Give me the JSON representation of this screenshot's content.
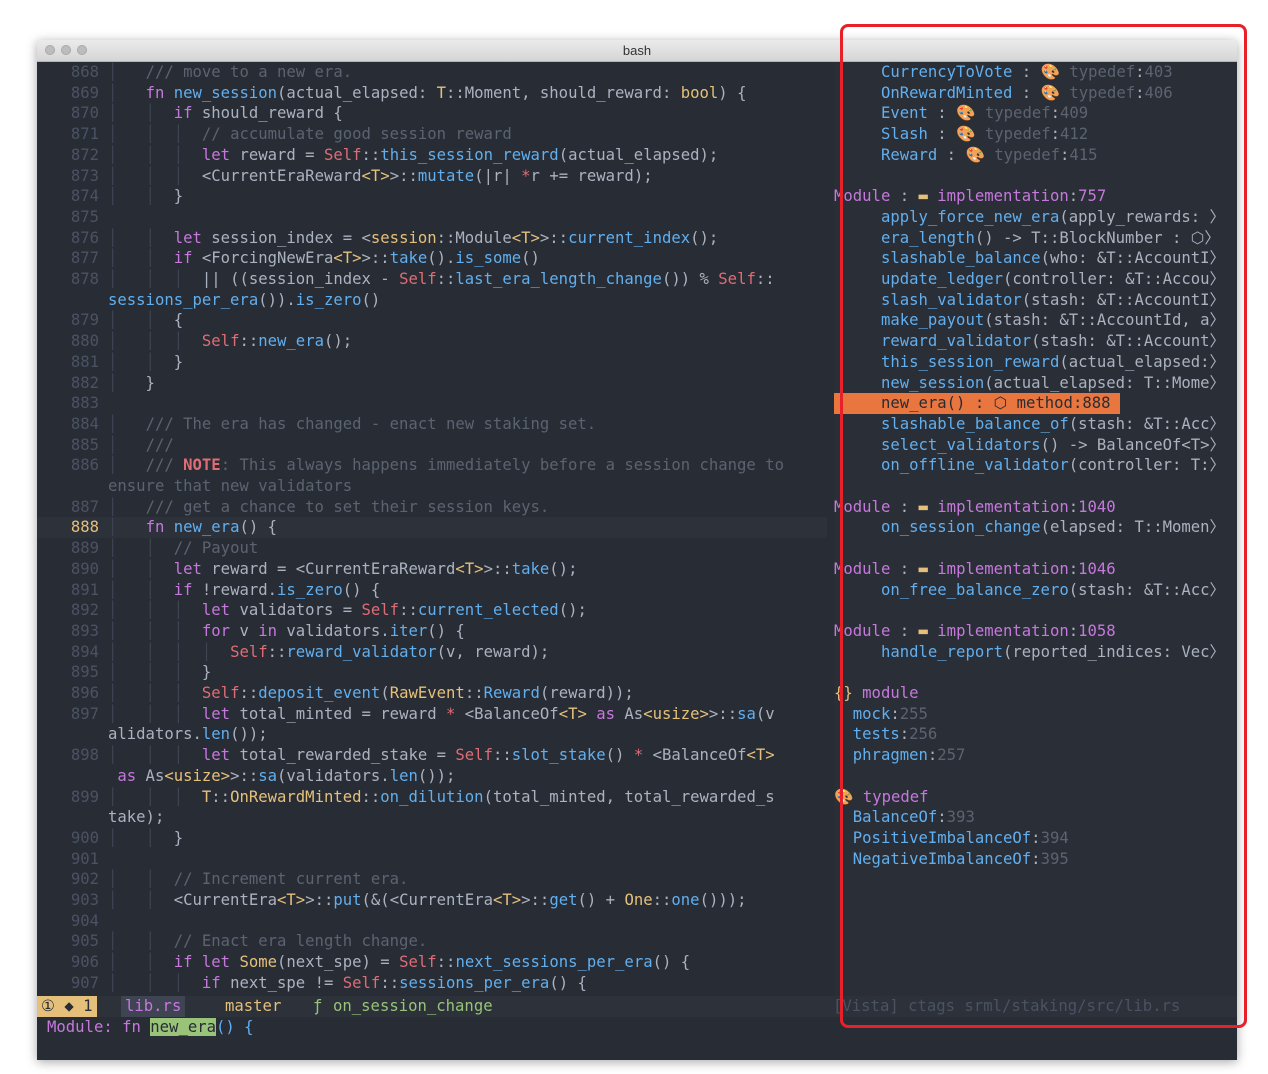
{
  "window": {
    "title": "bash"
  },
  "code": {
    "lines": [
      {
        "n": "868",
        "html": "<span class='guide'>│ </span>  <span class='cm'>/// move to a new era.</span>"
      },
      {
        "n": "869",
        "html": "<span class='guide'>│ </span>  <span class='kw'>fn</span> <span class='fn'>new_session</span>(actual_elapsed: <span class='ty'>T</span>::Moment, should_reward: <span class='ty'>bool</span>) {"
      },
      {
        "n": "870",
        "html": "<span class='guide'>│ </span>  <span class='guide'>│ </span> <span class='kw'>if</span> should_reward {"
      },
      {
        "n": "871",
        "html": "<span class='guide'>│ </span>  <span class='guide'>│ </span> <span class='guide'>│ </span> <span class='cm'>// accumulate good session reward</span>"
      },
      {
        "n": "872",
        "html": "<span class='guide'>│ </span>  <span class='guide'>│ </span> <span class='guide'>│ </span> <span class='kw'>let</span> reward = <span class='sf'>Self</span>::<span class='fn'>this_session_reward</span>(actual_elapsed);"
      },
      {
        "n": "873",
        "html": "<span class='guide'>│ </span>  <span class='guide'>│ </span> <span class='guide'>│ </span> &lt;CurrentEraReward<span class='ty'>&lt;T&gt;</span>&gt;::<span class='fn'>mutate</span>(|r| <span class='sf'>*</span>r += reward);"
      },
      {
        "n": "874",
        "html": "<span class='guide'>│ </span>  <span class='guide'>│ </span> }"
      },
      {
        "n": "875",
        "html": ""
      },
      {
        "n": "876",
        "html": "<span class='guide'>│ </span>  <span class='guide'>│ </span> <span class='kw'>let</span> session_index = &lt;<span class='ty'>session</span>::Module<span class='ty'>&lt;T&gt;</span>&gt;::<span class='fn'>current_index</span>();"
      },
      {
        "n": "877",
        "html": "<span class='guide'>│ </span>  <span class='guide'>│ </span> <span class='kw'>if</span> &lt;ForcingNewEra<span class='ty'>&lt;T&gt;</span>&gt;::<span class='fn'>take</span>().<span class='fn'>is_some</span>()"
      },
      {
        "n": "878",
        "html": "<span class='guide'>│ </span>  <span class='guide'>│ </span> <span class='guide'>│ </span> || ((session_index - <span class='sf'>Self</span>::<span class='fn'>last_era_length_change</span>()) % <span class='sf'>Self</span>::"
      },
      {
        "n": "",
        "wrap": true,
        "html": "<span class='fn'>sessions_per_era</span>()).<span class='fn'>is_zero</span>()"
      },
      {
        "n": "879",
        "html": "<span class='guide'>│ </span>  <span class='guide'>│ </span> {"
      },
      {
        "n": "880",
        "html": "<span class='guide'>│ </span>  <span class='guide'>│ </span> <span class='guide'>│ </span> <span class='sf'>Self</span>::<span class='fn'>new_era</span>();"
      },
      {
        "n": "881",
        "html": "<span class='guide'>│ </span>  <span class='guide'>│ </span> }"
      },
      {
        "n": "882",
        "html": "<span class='guide'>│ </span>  }"
      },
      {
        "n": "883",
        "html": ""
      },
      {
        "n": "884",
        "html": "<span class='guide'>│ </span>  <span class='cm'>/// The era has changed - enact new staking set.</span>"
      },
      {
        "n": "885",
        "html": "<span class='guide'>│ </span>  <span class='cm'>///</span>"
      },
      {
        "n": "886",
        "html": "<span class='guide'>│ </span>  <span class='cm'>/// </span><span class='note'>NOTE</span><span class='cm'>: This always happens immediately before a session change to</span>"
      },
      {
        "n": "",
        "wrap": true,
        "html": "<span class='cm'>ensure that new validators</span>"
      },
      {
        "n": "887",
        "html": "<span class='guide'>│ </span>  <span class='cm'>/// get a chance to set their session keys.</span>"
      },
      {
        "n": "888",
        "cur": true,
        "html": "<span class='guide'>│ </span>  <span class='kw'>fn</span> <span class='fn'>new_era</span>() {"
      },
      {
        "n": "889",
        "html": "<span class='guide'>│ </span>  <span class='guide'>│ </span> <span class='cm'>// Payout</span>"
      },
      {
        "n": "890",
        "html": "<span class='guide'>│ </span>  <span class='guide'>│ </span> <span class='kw'>let</span> reward = &lt;CurrentEraReward<span class='ty'>&lt;T&gt;</span>&gt;::<span class='fn'>take</span>();"
      },
      {
        "n": "891",
        "html": "<span class='guide'>│ </span>  <span class='guide'>│ </span> <span class='kw'>if</span> !reward.<span class='fn'>is_zero</span>() {"
      },
      {
        "n": "892",
        "html": "<span class='guide'>│ </span>  <span class='guide'>│ </span> <span class='guide'>│ </span> <span class='kw'>let</span> validators = <span class='sf'>Self</span>::<span class='fn'>current_elected</span>();"
      },
      {
        "n": "893",
        "html": "<span class='guide'>│ </span>  <span class='guide'>│ </span> <span class='guide'>│ </span> <span class='kw'>for</span> v <span class='kw'>in</span> validators.<span class='fn'>iter</span>() {"
      },
      {
        "n": "894",
        "html": "<span class='guide'>│ </span>  <span class='guide'>│ </span> <span class='guide'>│ </span> <span class='guide'>│ </span> <span class='sf'>Self</span>::<span class='fn'>reward_validator</span>(v, reward);"
      },
      {
        "n": "895",
        "html": "<span class='guide'>│ </span>  <span class='guide'>│ </span> <span class='guide'>│ </span> }"
      },
      {
        "n": "896",
        "html": "<span class='guide'>│ </span>  <span class='guide'>│ </span> <span class='guide'>│ </span> <span class='sf'>Self</span>::<span class='fn'>deposit_event</span>(<span class='ty'>RawEvent</span>::<span class='fn'>Reward</span>(reward));"
      },
      {
        "n": "897",
        "html": "<span class='guide'>│ </span>  <span class='guide'>│ </span> <span class='guide'>│ </span> <span class='kw'>let</span> total_minted = reward <span class='sf'>*</span> &lt;BalanceOf<span class='ty'>&lt;T&gt;</span> <span class='kw'>as</span> As<span class='ty'>&lt;usize&gt;</span>&gt;::<span class='fn'>sa</span>(v"
      },
      {
        "n": "",
        "wrap": true,
        "html": "alidators.<span class='fn'>len</span>());"
      },
      {
        "n": "898",
        "html": "<span class='guide'>│ </span>  <span class='guide'>│ </span> <span class='guide'>│ </span> <span class='kw'>let</span> total_rewarded_stake = <span class='sf'>Self</span>::<span class='fn'>slot_stake</span>() <span class='sf'>*</span> &lt;BalanceOf<span class='ty'>&lt;T&gt;</span>"
      },
      {
        "n": "",
        "wrap": true,
        "html": " <span class='kw'>as</span> As<span class='ty'>&lt;usize&gt;</span>&gt;::<span class='fn'>sa</span>(validators.<span class='fn'>len</span>());"
      },
      {
        "n": "899",
        "html": "<span class='guide'>│ </span>  <span class='guide'>│ </span> <span class='guide'>│ </span> <span class='ty'>T</span>::<span class='ty'>OnRewardMinted</span>::<span class='fn'>on_dilution</span>(total_minted, total_rewarded_s"
      },
      {
        "n": "",
        "wrap": true,
        "html": "take);"
      },
      {
        "n": "900",
        "html": "<span class='guide'>│ </span>  <span class='guide'>│ </span> }"
      },
      {
        "n": "901",
        "html": ""
      },
      {
        "n": "902",
        "html": "<span class='guide'>│ </span>  <span class='guide'>│ </span> <span class='cm'>// Increment current era.</span>"
      },
      {
        "n": "903",
        "html": "<span class='guide'>│ </span>  <span class='guide'>│ </span> &lt;CurrentEra<span class='ty'>&lt;T&gt;</span>&gt;::<span class='fn'>put</span>(&amp;(&lt;CurrentEra<span class='ty'>&lt;T&gt;</span>&gt;::<span class='fn'>get</span>() + <span class='ty'>One</span>::<span class='fn'>one</span>()));"
      },
      {
        "n": "904",
        "html": ""
      },
      {
        "n": "905",
        "html": "<span class='guide'>│ </span>  <span class='guide'>│ </span> <span class='cm'>// Enact era length change.</span>"
      },
      {
        "n": "906",
        "html": "<span class='guide'>│ </span>  <span class='guide'>│ </span> <span class='kw'>if let</span> <span class='ty'>Some</span>(next_spe) = <span class='sf'>Self</span>::<span class='fn'>next_sessions_per_era</span>() {"
      },
      {
        "n": "907",
        "html": "<span class='guide'>│ </span>  <span class='guide'>│ </span> <span class='guide'>│ </span> <span class='kw'>if</span> next_spe != <span class='sf'>Self</span>::<span class='fn'>sessions_per_era</span>() {"
      }
    ]
  },
  "vista": {
    "lines": [
      {
        "html": "     <span class='vfn'>CurrencyToVote</span> : <span class='icon'>🎨</span> <span class='vdim'>typedef</span>:<span class='vdim'>403</span>"
      },
      {
        "html": "     <span class='vfn'>OnRewardMinted</span> : <span class='icon'>🎨</span> <span class='vdim'>typedef</span>:<span class='vdim'>406</span>"
      },
      {
        "html": "     <span class='vfn'>Event</span> : <span class='icon'>🎨</span> <span class='vdim'>typedef</span>:<span class='vdim'>409</span>"
      },
      {
        "html": "     <span class='vfn'>Slash</span> : <span class='icon'>🎨</span> <span class='vdim'>typedef</span>:<span class='vdim'>412</span>"
      },
      {
        "html": "     <span class='vfn'>Reward</span> : <span class='icon'>🎨</span> <span class='vdim'>typedef</span>:<span class='vdim'>415</span>"
      },
      {
        "html": ""
      },
      {
        "html": "<span class='vpur'>Module</span> : <span class='icon'>▬</span> <span class='vpur'>implementation</span>:<span class='vpur'>757</span>"
      },
      {
        "html": "     <span class='vfn'>apply_force_new_era</span>(apply_rewards: 〉"
      },
      {
        "html": "     <span class='vfn'>era_length</span>() -&gt; T::BlockNumber : ⬡〉"
      },
      {
        "html": "     <span class='vfn'>slashable_balance</span>(who: &amp;T::AccountI〉"
      },
      {
        "html": "     <span class='vfn'>update_ledger</span>(controller: &amp;T::Accou〉"
      },
      {
        "html": "     <span class='vfn'>slash_validator</span>(stash: &amp;T::AccountI〉"
      },
      {
        "html": "     <span class='vfn'>make_payout</span>(stash: &amp;T::AccountId, a〉"
      },
      {
        "html": "     <span class='vfn'>reward_validator</span>(stash: &amp;T::Account〉"
      },
      {
        "html": "     <span class='vfn'>this_session_reward</span>(actual_elapsed:〉"
      },
      {
        "html": "     <span class='vfn'>new_session</span>(actual_elapsed: T::Mome〉"
      },
      {
        "sel": true,
        "html": "     <span>new_era() : ⬡ method:888</span>"
      },
      {
        "html": "     <span class='vfn'>slashable_balance_of</span>(stash: &amp;T::Acc〉"
      },
      {
        "html": "     <span class='vfn'>select_validators</span>() -&gt; BalanceOf&lt;T&gt;〉"
      },
      {
        "html": "     <span class='vfn'>on_offline_validator</span>(controller: T:〉"
      },
      {
        "html": ""
      },
      {
        "html": "<span class='vpur'>Module</span> : <span class='icon'>▬</span> <span class='vpur'>implementation</span>:<span class='vpur'>1040</span>"
      },
      {
        "html": "     <span class='vfn'>on_session_change</span>(elapsed: T::Momen〉"
      },
      {
        "html": ""
      },
      {
        "html": "<span class='vpur'>Module</span> : <span class='icon'>▬</span> <span class='vpur'>implementation</span>:<span class='vpur'>1046</span>"
      },
      {
        "html": "     <span class='vfn'>on_free_balance_zero</span>(stash: &amp;T::Acc〉"
      },
      {
        "html": ""
      },
      {
        "html": "<span class='vpur'>Module</span> : <span class='icon'>▬</span> <span class='vpur'>implementation</span>:<span class='vpur'>1058</span>"
      },
      {
        "html": "     <span class='vfn'>handle_report</span>(reported_indices: Vec〉"
      },
      {
        "html": ""
      },
      {
        "html": "<span class='icon'>{}</span> <span class='vpur'>module</span>"
      },
      {
        "html": "  <span class='vfn'>mock</span>:<span class='vdim'>255</span>"
      },
      {
        "html": "  <span class='vfn'>tests</span>:<span class='vdim'>256</span>"
      },
      {
        "html": "  <span class='vfn'>phragmen</span>:<span class='vdim'>257</span>"
      },
      {
        "html": ""
      },
      {
        "html": "<span class='icon'>🎨</span> <span class='vpur'>typedef</span>"
      },
      {
        "html": "  <span class='vfn'>BalanceOf</span>:<span class='vdim'>393</span>"
      },
      {
        "html": "  <span class='vfn'>PositiveImbalanceOf</span>:<span class='vdim'>394</span>"
      },
      {
        "html": "  <span class='vfn'>NegativeImbalanceOf</span>:<span class='vdim'>395</span>"
      }
    ]
  },
  "statusline": {
    "mode": "① ◆ 1",
    "file": "lib.rs",
    "branch_icon": "",
    "branch": "master",
    "func_icon": "ƒ",
    "func": "on_session_change",
    "vista": "[Vista] ctags srml/staking/src/lib.rs"
  },
  "cmdline": {
    "prefix": "Module: ",
    "kw": "fn",
    "name": "new_era",
    "suffix": "() {"
  },
  "colors": {
    "highlight": "#e8763e",
    "redbox": "#e8202a"
  }
}
